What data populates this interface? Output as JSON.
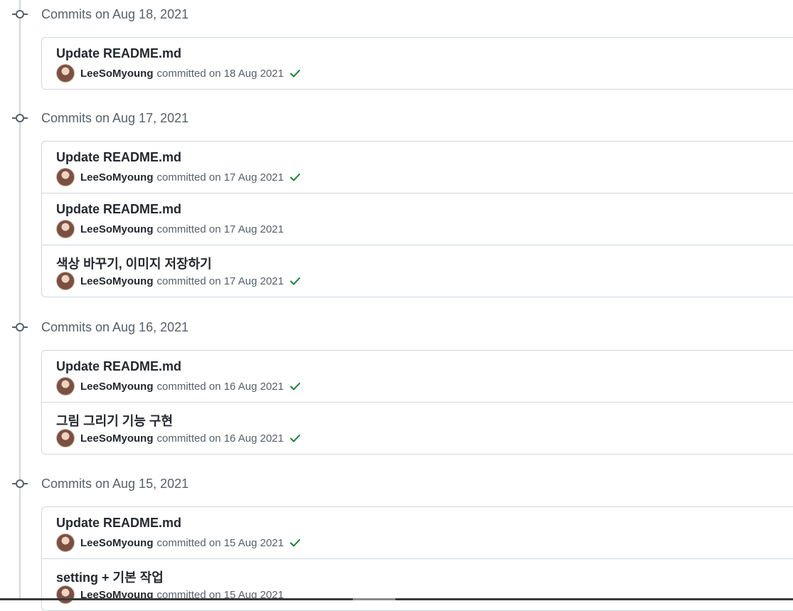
{
  "groups": [
    {
      "title": "Commits on Aug 18, 2021",
      "commits": [
        {
          "message": "Update README.md",
          "author": "LeeSoMyoung",
          "committed_text": "committed on 18 Aug 2021",
          "verified": true
        }
      ]
    },
    {
      "title": "Commits on Aug 17, 2021",
      "commits": [
        {
          "message": "Update README.md",
          "author": "LeeSoMyoung",
          "committed_text": "committed on 17 Aug 2021",
          "verified": true
        },
        {
          "message": "Update README.md",
          "author": "LeeSoMyoung",
          "committed_text": "committed on 17 Aug 2021",
          "verified": false
        },
        {
          "message": "색상 바꾸기, 이미지 저장하기",
          "author": "LeeSoMyoung",
          "committed_text": "committed on 17 Aug 2021",
          "verified": true
        }
      ]
    },
    {
      "title": "Commits on Aug 16, 2021",
      "commits": [
        {
          "message": "Update README.md",
          "author": "LeeSoMyoung",
          "committed_text": "committed on 16 Aug 2021",
          "verified": true
        },
        {
          "message": "그림 그리기 기능 구현",
          "author": "LeeSoMyoung",
          "committed_text": "committed on 16 Aug 2021",
          "verified": true
        }
      ]
    },
    {
      "title": "Commits on Aug 15, 2021",
      "commits": [
        {
          "message": "Update README.md",
          "author": "LeeSoMyoung",
          "committed_text": "committed on 15 Aug 2021",
          "verified": true
        },
        {
          "message": "setting + 기본 작업",
          "author": "LeeSoMyoung",
          "committed_text": "committed on 15 Aug 2021",
          "verified": false
        }
      ]
    }
  ],
  "colors": {
    "check": "#1a7f37",
    "muted_text": "#57606a",
    "border": "#d0d7de"
  },
  "icons": {
    "timeline_node": "git-commit-icon",
    "status": "check-icon"
  }
}
